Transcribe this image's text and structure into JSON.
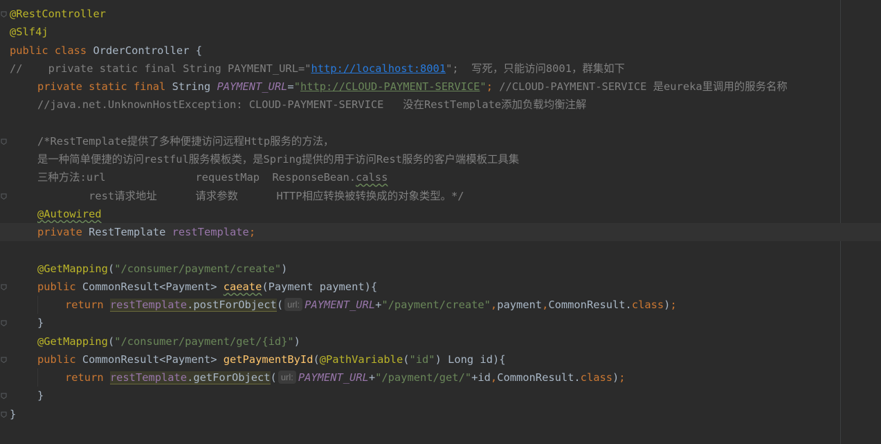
{
  "editor": {
    "lines": [
      {
        "fold": true,
        "tokens": [
          [
            "ann",
            "@RestController"
          ]
        ]
      },
      {
        "tokens": [
          [
            "ann",
            "@Slf4j"
          ]
        ]
      },
      {
        "tokens": [
          [
            "kw",
            "public class "
          ],
          [
            "plain",
            "OrderController {"
          ]
        ]
      },
      {
        "tokens": [
          [
            "cm",
            "//    private static final String PAYMENT_URL=\""
          ],
          [
            "cmurl",
            "http://localhost:8001"
          ],
          [
            "cm",
            "\";  写死，只能访问8001，群集如下"
          ]
        ]
      },
      {
        "indent": 1,
        "tokens": [
          [
            "kw",
            "private static final "
          ],
          [
            "plain",
            "String "
          ],
          [
            "const",
            "PAYMENT_URL"
          ],
          [
            "plain",
            "="
          ],
          [
            "str",
            "\""
          ],
          [
            "urlstr",
            "http://CLOUD-PAYMENT-SERVICE"
          ],
          [
            "str",
            "\""
          ],
          [
            "kw",
            "; "
          ],
          [
            "cm",
            "//CLOUD-PAYMENT-SERVICE 是eureka里调用的服务名称"
          ]
        ]
      },
      {
        "indent": 1,
        "tokens": [
          [
            "cm",
            "//java.net.UnknownHostException: CLOUD-PAYMENT-SERVICE   没在RestTemplate添加负载均衡注解"
          ]
        ]
      },
      {
        "tokens": []
      },
      {
        "indent": 1,
        "fold": true,
        "tokens": [
          [
            "cm",
            "/*RestTemplate提供了多种便捷访问远程Http服务的方法，"
          ]
        ]
      },
      {
        "indent": 1,
        "tokens": [
          [
            "cm",
            "是一种简单便捷的访问restful服务模板类，是Spring提供的用于访问Rest服务的客户端模板工具集"
          ]
        ]
      },
      {
        "indent": 1,
        "tokens": [
          [
            "cm",
            "三种方法:url              requestMap  ResponseBean."
          ],
          [
            "cmwavy",
            "calss"
          ]
        ]
      },
      {
        "indent": 1,
        "fold": true,
        "tokens": [
          [
            "cm",
            "        rest请求地址      请求参数      HTTP相应转换被转换成的对象类型。*/"
          ]
        ]
      },
      {
        "indent": 1,
        "tokens": [
          [
            "annwavy",
            "@Autowired"
          ]
        ]
      },
      {
        "indent": 1,
        "current": true,
        "tokens": [
          [
            "kw",
            "private "
          ],
          [
            "plain",
            "RestTemplate "
          ],
          [
            "field",
            "restTemplate"
          ],
          [
            "kw",
            ";"
          ]
        ]
      },
      {
        "tokens": []
      },
      {
        "indent": 1,
        "tokens": [
          [
            "ann",
            "@GetMapping"
          ],
          [
            "plain",
            "("
          ],
          [
            "str",
            "\"/consumer/payment/create\""
          ],
          [
            "plain",
            ")"
          ]
        ]
      },
      {
        "indent": 1,
        "fold": true,
        "tokens": [
          [
            "kw",
            "public "
          ],
          [
            "plain",
            "CommonResult<Payment> "
          ],
          [
            "fnwavy",
            "caeate"
          ],
          [
            "plain",
            "(Payment payment){"
          ]
        ]
      },
      {
        "indent": 2,
        "tokens": [
          [
            "kw",
            "return "
          ],
          [
            "hlfield",
            "restTemplate"
          ],
          [
            "hlplain",
            ".postForObject"
          ],
          [
            "plain",
            "("
          ],
          [
            "hint",
            "url:"
          ],
          [
            "const",
            "PAYMENT_URL"
          ],
          [
            "plain",
            "+"
          ],
          [
            "str",
            "\"/payment/create\""
          ],
          [
            "kw",
            ","
          ],
          [
            "plain",
            "payment"
          ],
          [
            "kw",
            ","
          ],
          [
            "plain",
            "CommonResult."
          ],
          [
            "kw",
            "class"
          ],
          [
            "plain",
            ")"
          ],
          [
            "kw",
            ";"
          ]
        ]
      },
      {
        "indent": 1,
        "fold": true,
        "tokens": [
          [
            "plain",
            "}"
          ]
        ]
      },
      {
        "indent": 1,
        "tokens": [
          [
            "ann",
            "@GetMapping"
          ],
          [
            "plain",
            "("
          ],
          [
            "str",
            "\"/consumer/payment/get/{id}\""
          ],
          [
            "plain",
            ")"
          ]
        ]
      },
      {
        "indent": 1,
        "fold": true,
        "tokens": [
          [
            "kw",
            "public "
          ],
          [
            "plain",
            "CommonResult<Payment> "
          ],
          [
            "fn",
            "getPaymentById"
          ],
          [
            "plain",
            "("
          ],
          [
            "ann",
            "@PathVariable"
          ],
          [
            "plain",
            "("
          ],
          [
            "str",
            "\"id\""
          ],
          [
            "plain",
            ") Long id){"
          ]
        ]
      },
      {
        "indent": 2,
        "tokens": [
          [
            "kw",
            "return "
          ],
          [
            "hlfield",
            "restTemplate"
          ],
          [
            "hlplain",
            ".getForObject"
          ],
          [
            "plain",
            "("
          ],
          [
            "hint",
            "url:"
          ],
          [
            "const",
            "PAYMENT_URL"
          ],
          [
            "plain",
            "+"
          ],
          [
            "str",
            "\"/payment/get/\""
          ],
          [
            "plain",
            "+id"
          ],
          [
            "kw",
            ","
          ],
          [
            "plain",
            "CommonResult."
          ],
          [
            "kw",
            "class"
          ],
          [
            "plain",
            ")"
          ],
          [
            "kw",
            ";"
          ]
        ]
      },
      {
        "indent": 1,
        "fold": true,
        "tokens": [
          [
            "plain",
            "}"
          ]
        ]
      },
      {
        "fold": true,
        "tokens": [
          [
            "plain",
            "}"
          ]
        ]
      }
    ]
  }
}
